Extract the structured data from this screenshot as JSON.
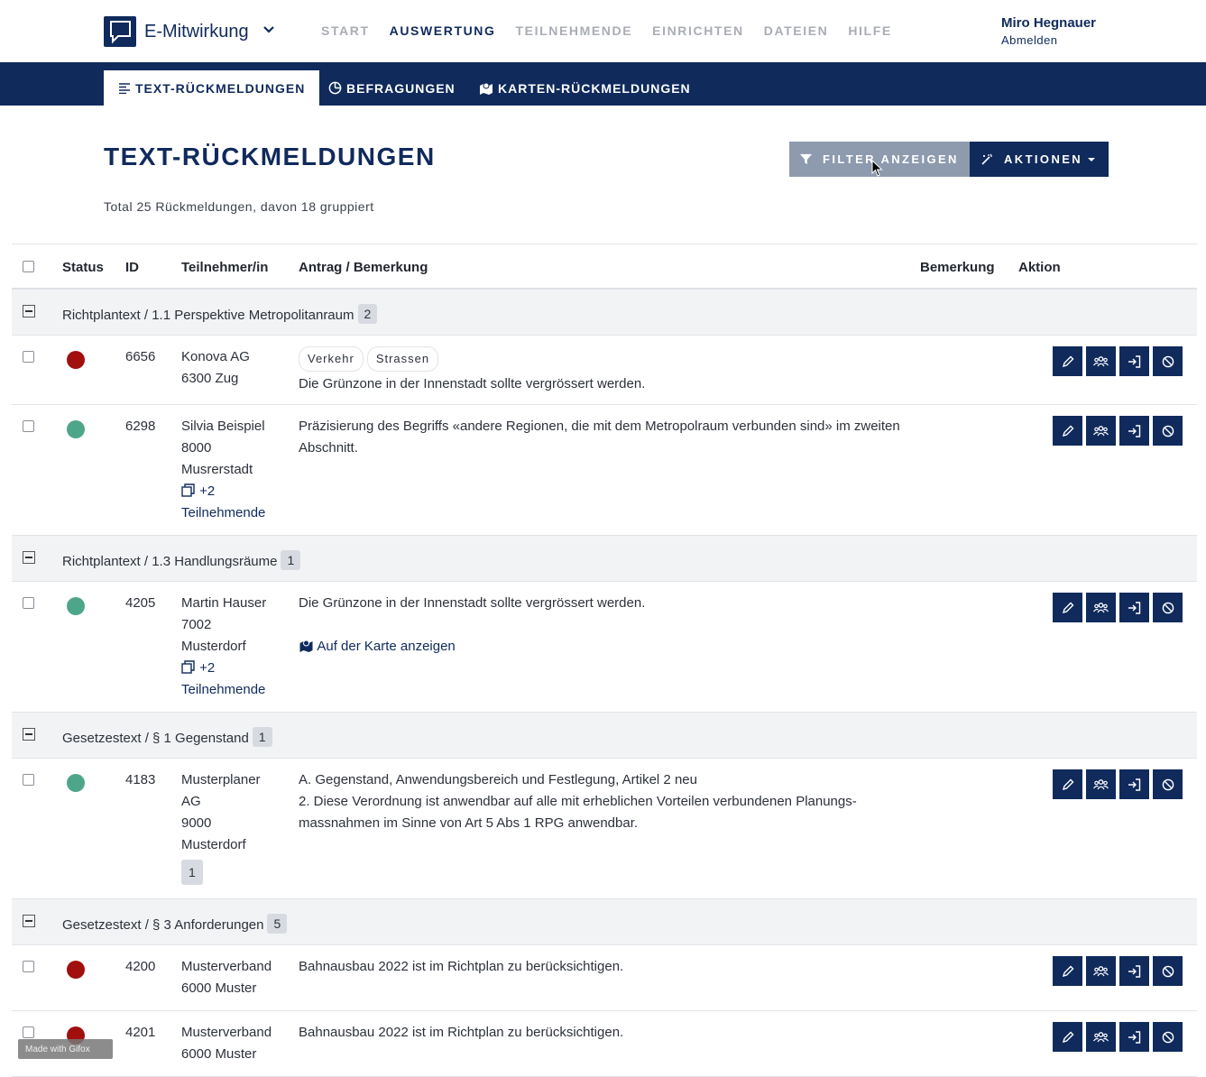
{
  "app": {
    "brand": "E-Mitwirkung"
  },
  "nav": {
    "items": [
      "START",
      "AUSWERTUNG",
      "TEILNEHMENDE",
      "EINRICHTEN",
      "DATEIEN",
      "HILFE"
    ],
    "active": "AUSWERTUNG"
  },
  "user": {
    "name": "Miro Hegnauer",
    "logout": "Abmelden"
  },
  "subnav": {
    "text": "TEXT-RÜCKMELDUNGEN",
    "surveys": "BEFRAGUNGEN",
    "map": "KARTEN-RÜCKMELDUNGEN"
  },
  "page": {
    "title": "TEXT-RÜCKMELDUNGEN",
    "summary": "Total 25 Rückmeldungen, davon 18 gruppiert",
    "filter_label": "FILTER ANZEIGEN",
    "actions_label": "AKTIONEN"
  },
  "table": {
    "headers": {
      "status": "Status",
      "id": "ID",
      "participant": "Teilnehmer/in",
      "request": "Antrag / Bemerkung",
      "remark": "Bemerkung",
      "action": "Aktion"
    },
    "groups": [
      {
        "label": "Richtplantext / 1.1 Perspektive Metropolitanraum",
        "count": "2"
      },
      {
        "label": "Richtplantext / 1.3 Handlungsräume",
        "count": "1"
      },
      {
        "label": "Gesetzestext / § 1 Gegenstand",
        "count": "1"
      },
      {
        "label": "Gesetzestext / § 3 Anforderungen",
        "count": "5"
      }
    ],
    "rows": [
      {
        "id": "6656",
        "status": "red",
        "p1": "Konova AG",
        "p2": "6300 Zug",
        "tags": [
          "Verkehr",
          "Strassen"
        ],
        "text": "Die Grünzone in der Innenstadt sollte vergrössert werden."
      },
      {
        "id": "6298",
        "status": "green",
        "p1": "Silvia Beispiel",
        "p2": "8000",
        "p3": "Musrerstadt",
        "more": "+2",
        "more_label": "Teilnehmende",
        "text": "Präzisierung des Begriffs «andere Regionen, die mit dem Metropolraum verbunden sind» im zweiten Abschnitt."
      },
      {
        "id": "4205",
        "status": "green",
        "p1": "Martin Hauser",
        "p2": "7002",
        "p3": "Musterdorf",
        "more": "+2",
        "more_label": "Teilnehmende",
        "text": "Die Grünzone in der Innenstadt sollte vergrössert werden.",
        "map_link": "Auf der Karte anzeigen"
      },
      {
        "id": "4183",
        "status": "green",
        "p1": "Musterplaner",
        "p2": "AG",
        "p3": "9000",
        "p4": "Musterdorf",
        "badge": "1",
        "text1": "A. Gegenstand, Anwendungsbereich und Festlegung, Artikel 2 neu",
        "text2": "2. Diese Verordnung ist anwendbar auf alle mit erheblichen Vorteilen verbundenen Planungs-massnahmen im Sinne von Art 5 Abs 1 RPG anwendbar."
      },
      {
        "id": "4200",
        "status": "red",
        "p1": "Musterverband",
        "p2": "6000 Muster",
        "text": "Bahnausbau 2022 ist im Richtplan zu berücksichtigen."
      },
      {
        "id": "4201",
        "status": "red",
        "p1": "Musterverband",
        "p2": "6000 Muster",
        "text": "Bahnausbau 2022 ist im Richtplan zu berücksichtigen."
      }
    ]
  },
  "watermark": "Made with Gifox",
  "colors": {
    "primary": "#102a5c",
    "filter": "#8e9aae",
    "red": "#a10f0f",
    "green": "#4ea68a"
  }
}
